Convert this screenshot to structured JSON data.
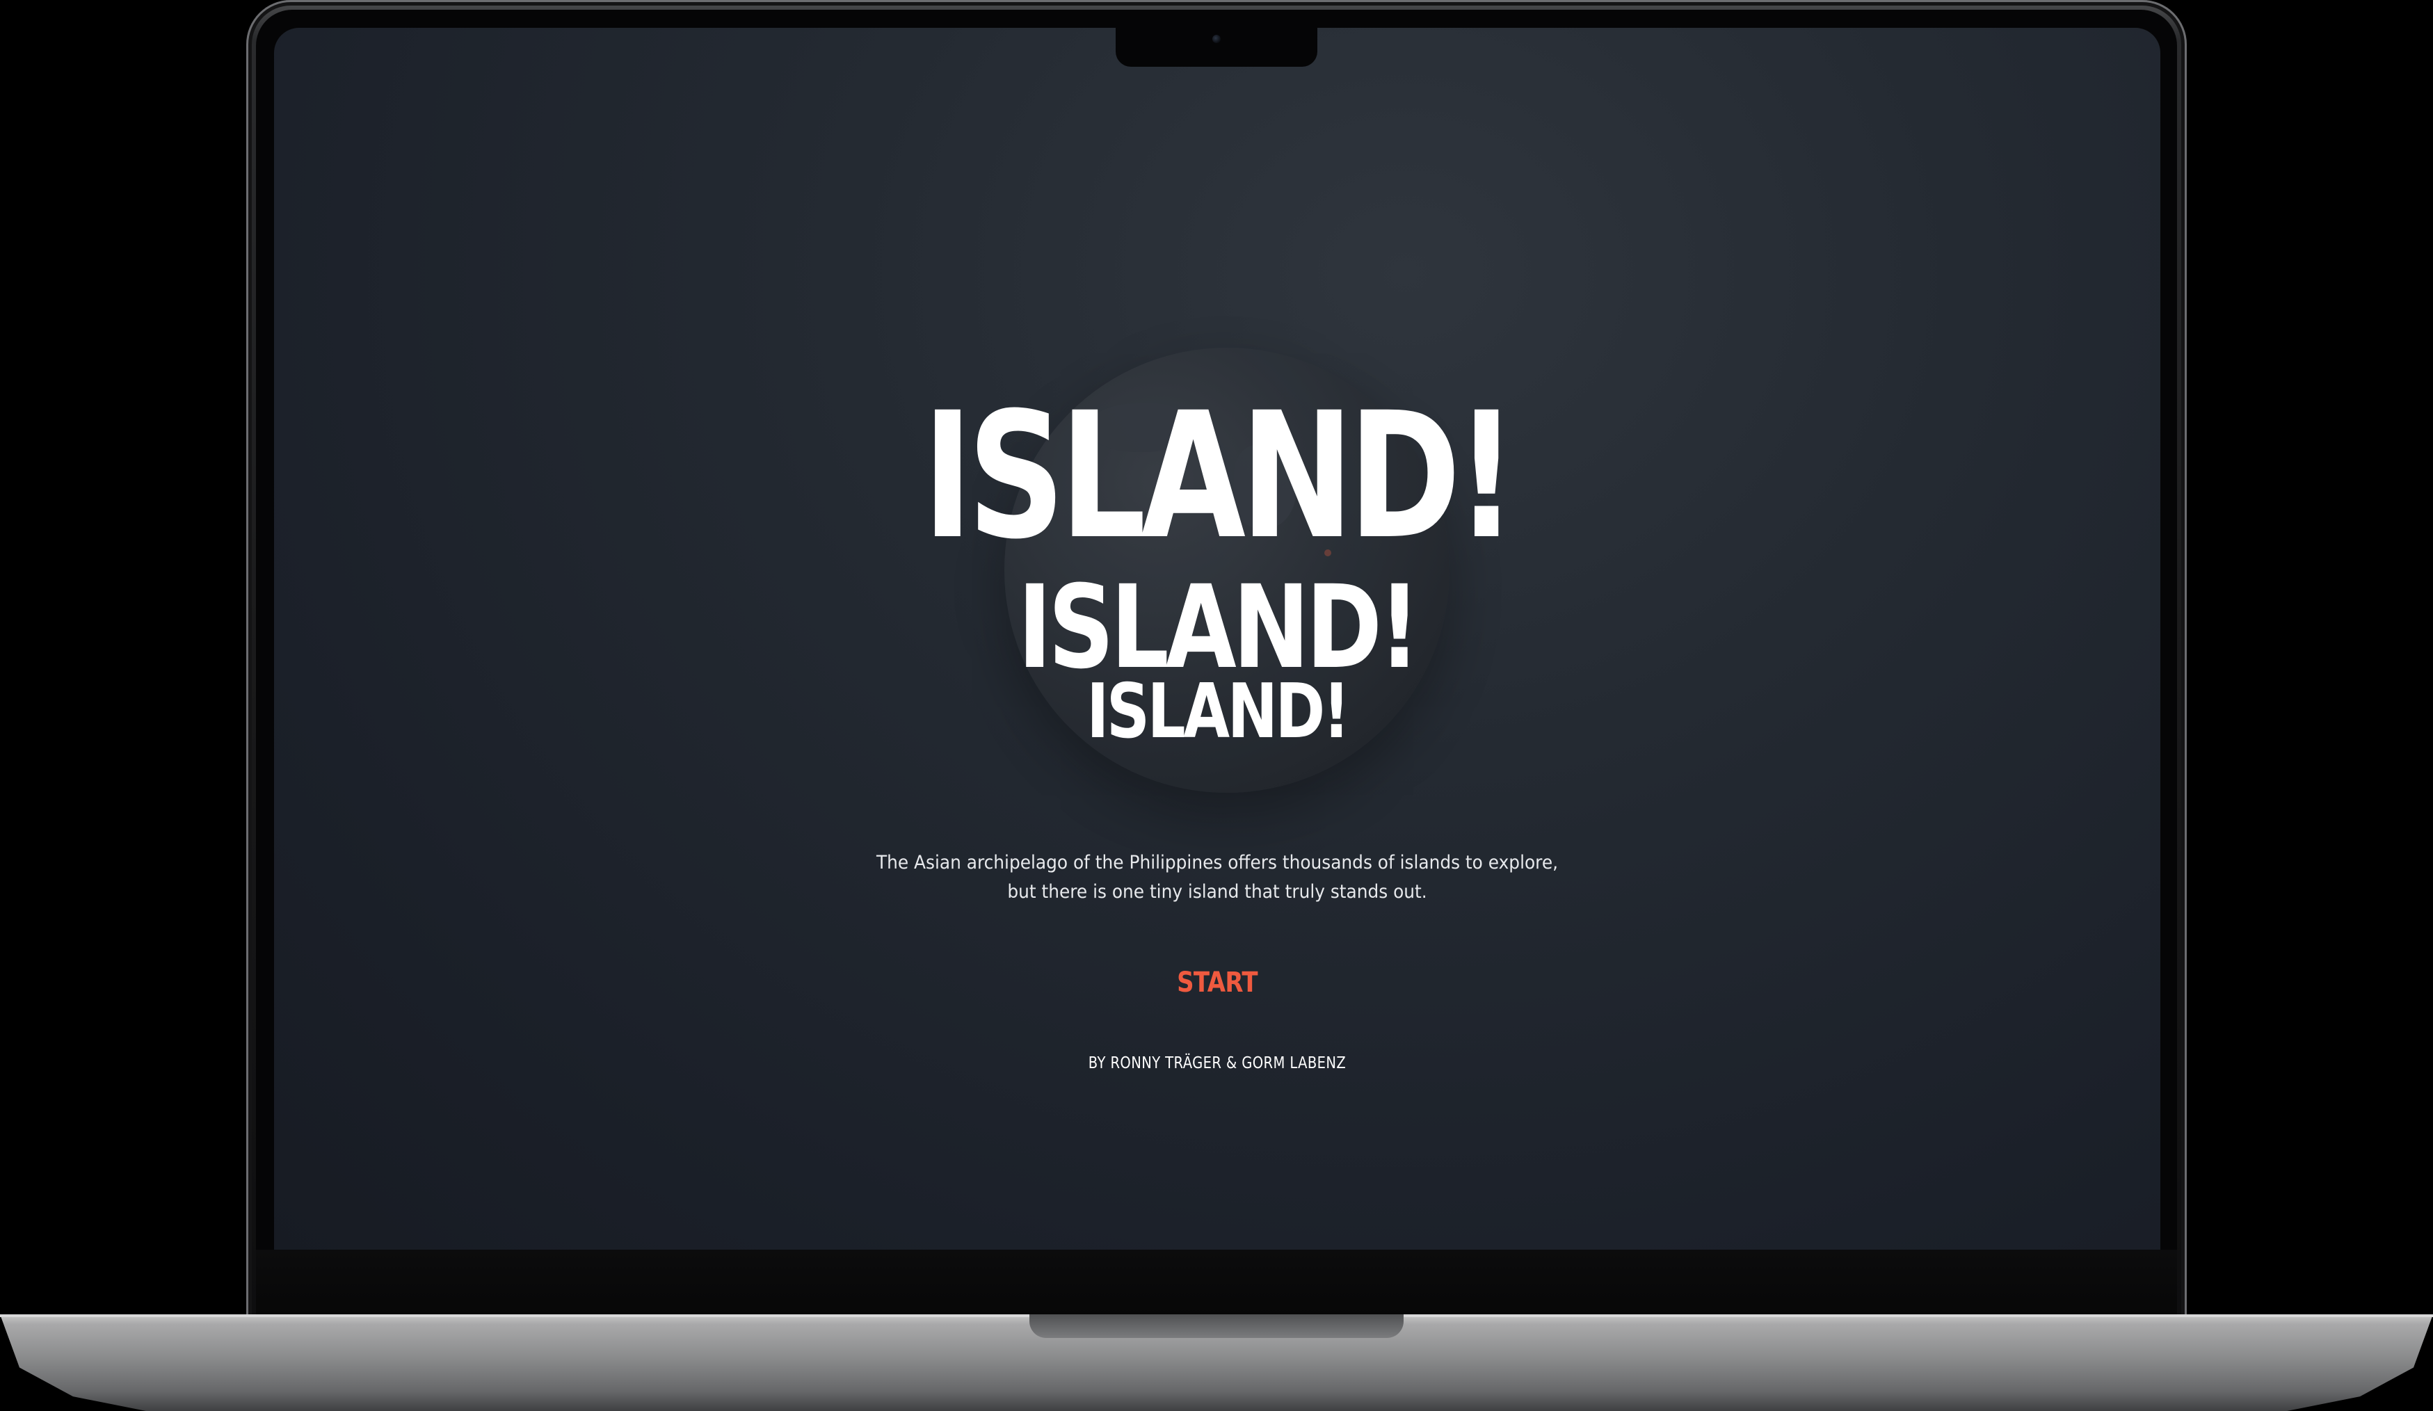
{
  "device": {
    "type": "laptop-mockup",
    "camera": "camera-icon"
  },
  "hero": {
    "headline_line1": "ISLAND!",
    "headline_line2": "ISLAND!",
    "headline_line3": "ISLAND!",
    "intro": "The Asian archipelago of the Philippines offers thousands of islands to explore, but there is one tiny island that truly stands out.",
    "start_label": "START",
    "byline": "BY RONNY TRÄGER & GORM LABENZ"
  },
  "colors": {
    "accent": "#ef5a3f",
    "background": "#1e232b",
    "text": "#ffffff"
  }
}
